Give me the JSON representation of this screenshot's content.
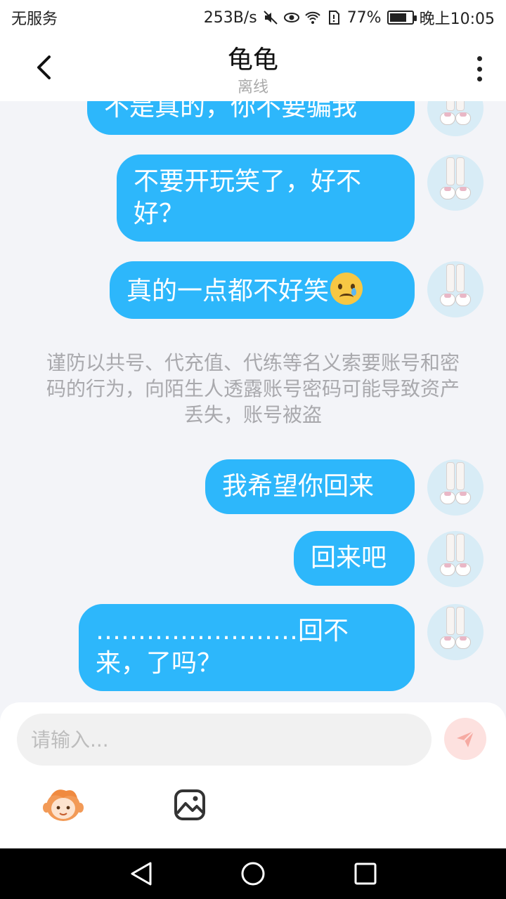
{
  "status_bar": {
    "carrier": "无服务",
    "speed": "253B/s",
    "battery": "77%",
    "battery_level": 0.77,
    "time": "晚上10:05",
    "icons": [
      "mute-icon",
      "eye-icon",
      "wifi-icon",
      "sim-icon",
      "battery-icon"
    ]
  },
  "header": {
    "title": "龟龟",
    "subtitle": "离线"
  },
  "messages": [
    {
      "text": "不是真的，你不要骗我"
    },
    {
      "text": "不要开玩笑了，好不好？"
    },
    {
      "text": "真的一点都不好笑",
      "emoji": "crying-face-emoji"
    },
    {
      "text": "我希望你回来"
    },
    {
      "text": "回来吧"
    },
    {
      "text": "……………………回不来，了吗？"
    }
  ],
  "system_note": "谨防以共号、代充值、代练等名义索要账号和密码的行为，向陌生人透露账号密码可能导致资产丢失，账号被盗",
  "input": {
    "placeholder": "请输入..."
  },
  "colors": {
    "bubble": "#2db7fb",
    "background": "#f3f4f8",
    "send": "#fde1df"
  }
}
